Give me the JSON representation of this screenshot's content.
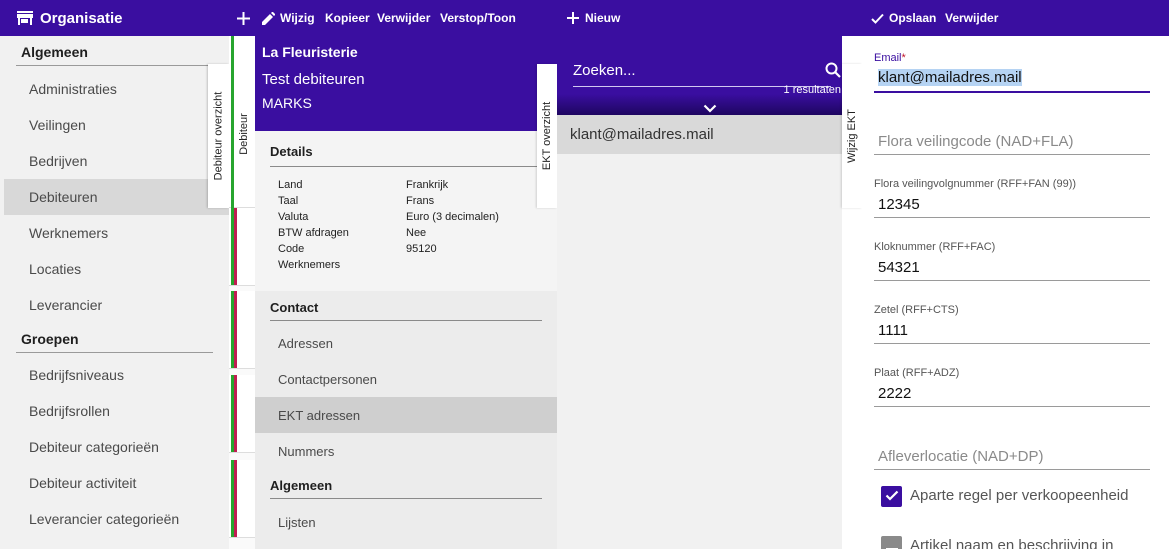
{
  "topbar": {
    "app_title": "Organisatie",
    "edit": "Wijzig",
    "copy": "Kopieer",
    "delete": "Verwijder",
    "hide_show": "Verstop/Toon",
    "new": "Nieuw",
    "save": "Opslaan",
    "delete_right": "Verwijder"
  },
  "sidebar": {
    "sections": [
      {
        "title": "Algemeen",
        "items": [
          "Administraties",
          "Veilingen",
          "Bedrijven",
          "Debiteuren",
          "Werknemers",
          "Locaties",
          "Leverancier"
        ]
      },
      {
        "title": "Groepen",
        "items": [
          "Bedrijfsniveaus",
          "Bedrijfsrollen",
          "Debiteur categorieën",
          "Debiteur activiteit",
          "Leverancier categorieën"
        ]
      }
    ],
    "active_item": "Debiteuren"
  },
  "vtabs": {
    "debiteur_overzicht": "Debiteur overzicht",
    "debiteur": "Debiteur",
    "ekt_overzicht": "EKT overzicht",
    "wijzig_ekt": "Wijzig EKT"
  },
  "detail": {
    "title": "La Fleuristerie",
    "subtitle": "Test debiteuren",
    "owner": "MARKS",
    "details_title": "Details",
    "fields": [
      {
        "label": "Land",
        "value": "Frankrijk"
      },
      {
        "label": "Taal",
        "value": "Frans"
      },
      {
        "label": "Valuta",
        "value": "Euro (3 decimalen)"
      },
      {
        "label": "BTW afdragen",
        "value": "Nee"
      },
      {
        "label": "Code",
        "value": "95120"
      },
      {
        "label": "Werknemers",
        "value": ""
      }
    ],
    "contact_title": "Contact",
    "contact_items": [
      "Adressen",
      "Contactpersonen",
      "EKT adressen",
      "Nummers"
    ],
    "active_item": "EKT adressen",
    "general_title": "Algemeen",
    "general_items": [
      "Lijsten"
    ]
  },
  "ekt_list": {
    "search_placeholder": "Zoeken...",
    "result_count": "1 resultaten",
    "rows": [
      "klant@mailadres.mail"
    ]
  },
  "form": {
    "email_label": "Email",
    "required_mark": "*",
    "email_value": "klant@mailadres.mail",
    "flora_code_placeholder": "Flora veilingcode (NAD+FLA)",
    "flora_seq_label": "Flora veilingvolgnummer (RFF+FAN (99))",
    "flora_seq_value": "12345",
    "clock_label": "Kloknummer (RFF+FAC)",
    "clock_value": "54321",
    "seat_label": "Zetel (RFF+CTS)",
    "seat_value": "1111",
    "plate_label": "Plaat (RFF+ADZ)",
    "plate_value": "2222",
    "delivery_placeholder": "Afleverlocatie (NAD+DP)",
    "checkbox1_label": "Aparte regel per verkoopeenheid",
    "checkbox2_label": "Artikel naam en beschrijving in"
  },
  "colors": {
    "primary": "#3a0ea0",
    "active_row": "#d8d8d8",
    "bar_green": "#27a52e",
    "bar_red": "#c01d52"
  }
}
